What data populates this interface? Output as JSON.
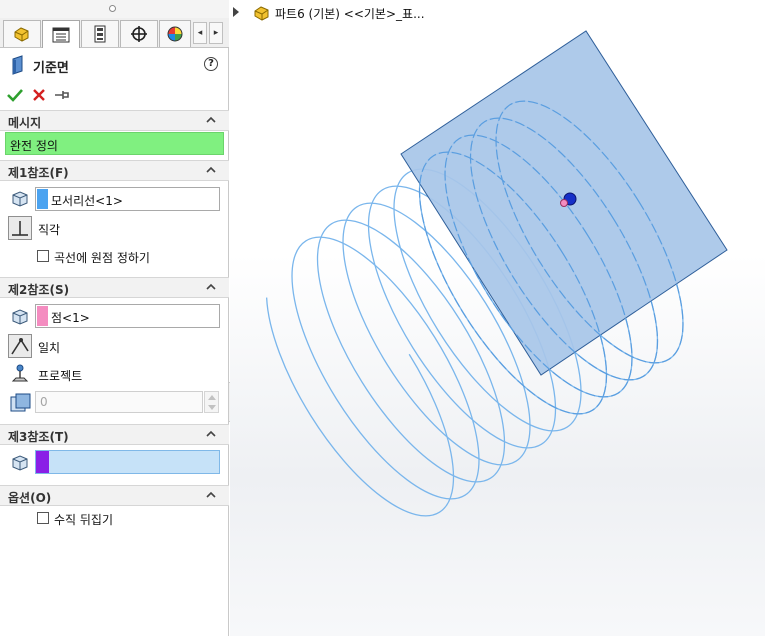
{
  "property_manager": {
    "title": "기준면",
    "help_icon": "?",
    "tabs": [
      "feature-manager-icon",
      "property-manager-icon",
      "config-manager-icon",
      "dimxpert-icon",
      "display-manager-icon"
    ],
    "actions": [
      "confirm-icon",
      "cancel-icon",
      "pin-icon"
    ],
    "message": {
      "header": "메시지",
      "text": "완전 정의",
      "status_color": "#80f080"
    },
    "first_reference": {
      "header": "제1참조(F)",
      "selection": "모서리선<1>",
      "swatch_color": "#4ba3f0",
      "constraint": "직각",
      "checkbox_label": "곡선에 원점 정하기",
      "checkbox_checked": false
    },
    "second_reference": {
      "header": "제2참조(S)",
      "selection": "점<1>",
      "swatch_color": "#f48cc0",
      "constraint_1": "일치",
      "constraint_2": "프로젝트",
      "distance_value": "0"
    },
    "third_reference": {
      "header": "제3참조(T)",
      "selection": "",
      "swatch_color": "#8a1fe6"
    },
    "options": {
      "header": "옵션(O)",
      "checkbox_label": "수직 뒤집기",
      "checkbox_checked": false
    }
  },
  "graphics": {
    "tree_label": "파트6 (기본) <<기본>_표...",
    "plane_color": "#a7c6e8",
    "helix_color": "#7ab6ec"
  }
}
